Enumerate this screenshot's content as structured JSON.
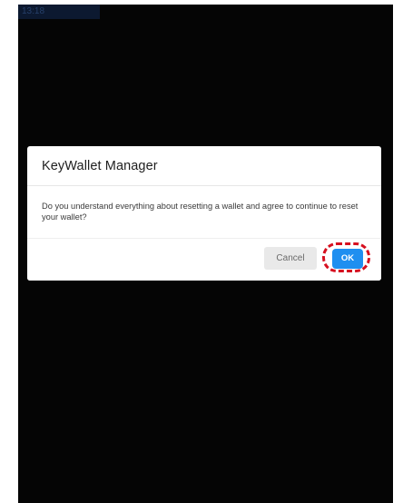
{
  "screen": {
    "top_tab_label": "13:18"
  },
  "dialog": {
    "title": "KeyWallet Manager",
    "message": "Do you understand everything about resetting a wallet and agree to continue to reset your wallet?",
    "cancel_label": "Cancel",
    "ok_label": "OK"
  },
  "colors": {
    "background": "#050505",
    "dialog_background": "#ffffff",
    "ok_button": "#1f8ff0",
    "cancel_button": "#e9e9e9",
    "highlight": "#d60f1f"
  }
}
